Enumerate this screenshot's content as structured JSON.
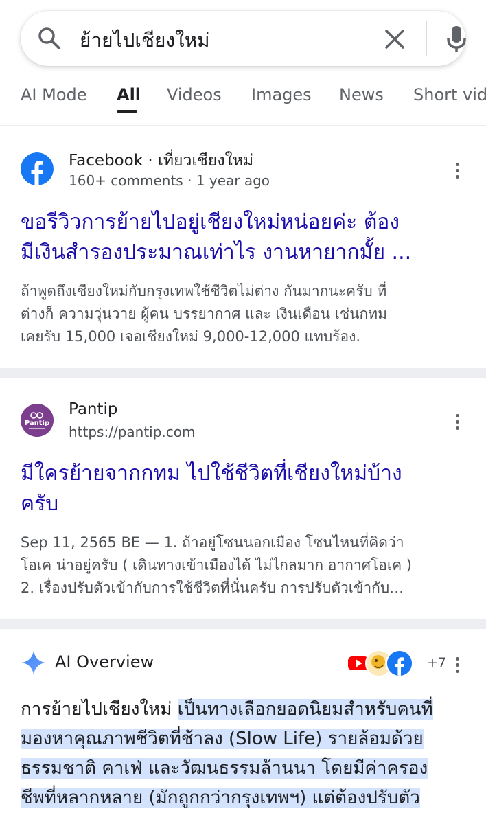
{
  "search": {
    "query": "ย้ายไปเชียงใหม่",
    "icons": [
      "search-icon",
      "clear-icon",
      "mic-icon"
    ]
  },
  "tabs": [
    {
      "label": "AI Mode",
      "active": false
    },
    {
      "label": "All",
      "active": true
    },
    {
      "label": "Videos",
      "active": false
    },
    {
      "label": "Images",
      "active": false
    },
    {
      "label": "News",
      "active": false
    },
    {
      "label": "Short vid",
      "active": false
    }
  ],
  "results": [
    {
      "site_name": "Facebook · เที่ยวเชียงใหม่",
      "meta": "160+ comments · 1 year ago",
      "title_lines": [
        "ขอรีวิวการย้ายไปอยู่เชียงใหม่หน่อยค่ะ ต้อง",
        "มีเงินสำรองประมาณเท่าไร งานหายากมั้ย ..."
      ],
      "snippet_lines": [
        "ถ้าพูดถึงเชียงใหม่กับกรุงเทพใช้ชีวิตไม่ต่าง กันมากนะครับ ที่",
        "ต่างก็ ความวุ่นวาย ผู้คน บรรยากาศ และ เงินเดือน เช่นกทม",
        "เคยรับ 15,000 เจอเชียงใหม่ 9,000-12,000 แทบร้อง."
      ],
      "favicon": "facebook-icon"
    },
    {
      "site_name": "Pantip",
      "meta": "https://pantip.com",
      "favicon_text": "Pantip",
      "title_lines": [
        "มีใครย้ายจากกทม ไปใช้ชีวิตที่เชียงใหม่บ้าง",
        "ครับ"
      ],
      "snippet_lines": [
        "Sep 11, 2565 BE — 1. ถ้าอยู่โซนนอกเมือง โซนไหนที่คิดว่า",
        "โอเค น่าอยู่ครับ ( เดินทางเข้าเมืองได้ ไม่ไกลมาก อากาศโอเค )",
        "2. เรื่องปรับตัวเข้ากับการใช้ชีวิตที่นั่นครับ การปรับตัวเข้ากับ…"
      ],
      "favicon": "pantip-icon"
    }
  ],
  "ai_overview": {
    "label": "AI Overview",
    "source_more": "+7",
    "source_icons": [
      "youtube-icon",
      "cartoon-source-icon",
      "facebook-icon"
    ],
    "lead": "การย้ายไปเชียงใหม่",
    "lines": [
      "เป็นทางเลือกยอดนิยมสำหรับคนที่",
      "มองหาคุณภาพชีวิตที่ช้าลง (Slow Life) รายล้อมด้วย",
      "ธรรมชาติ คาเฟ่ และวัฒนธรรมล้านนา โดยมีค่าครอง",
      "ชีพที่หลากหลาย (มักถูกกว่ากรุงเทพฯ) แต่ต้องปรับตัว"
    ]
  },
  "colors": {
    "link": "#1a0dab",
    "highlight": "#d3e3fd",
    "facebook": "#1877f2",
    "pantip": "#7b3f8e",
    "youtube": "#ff0000"
  }
}
